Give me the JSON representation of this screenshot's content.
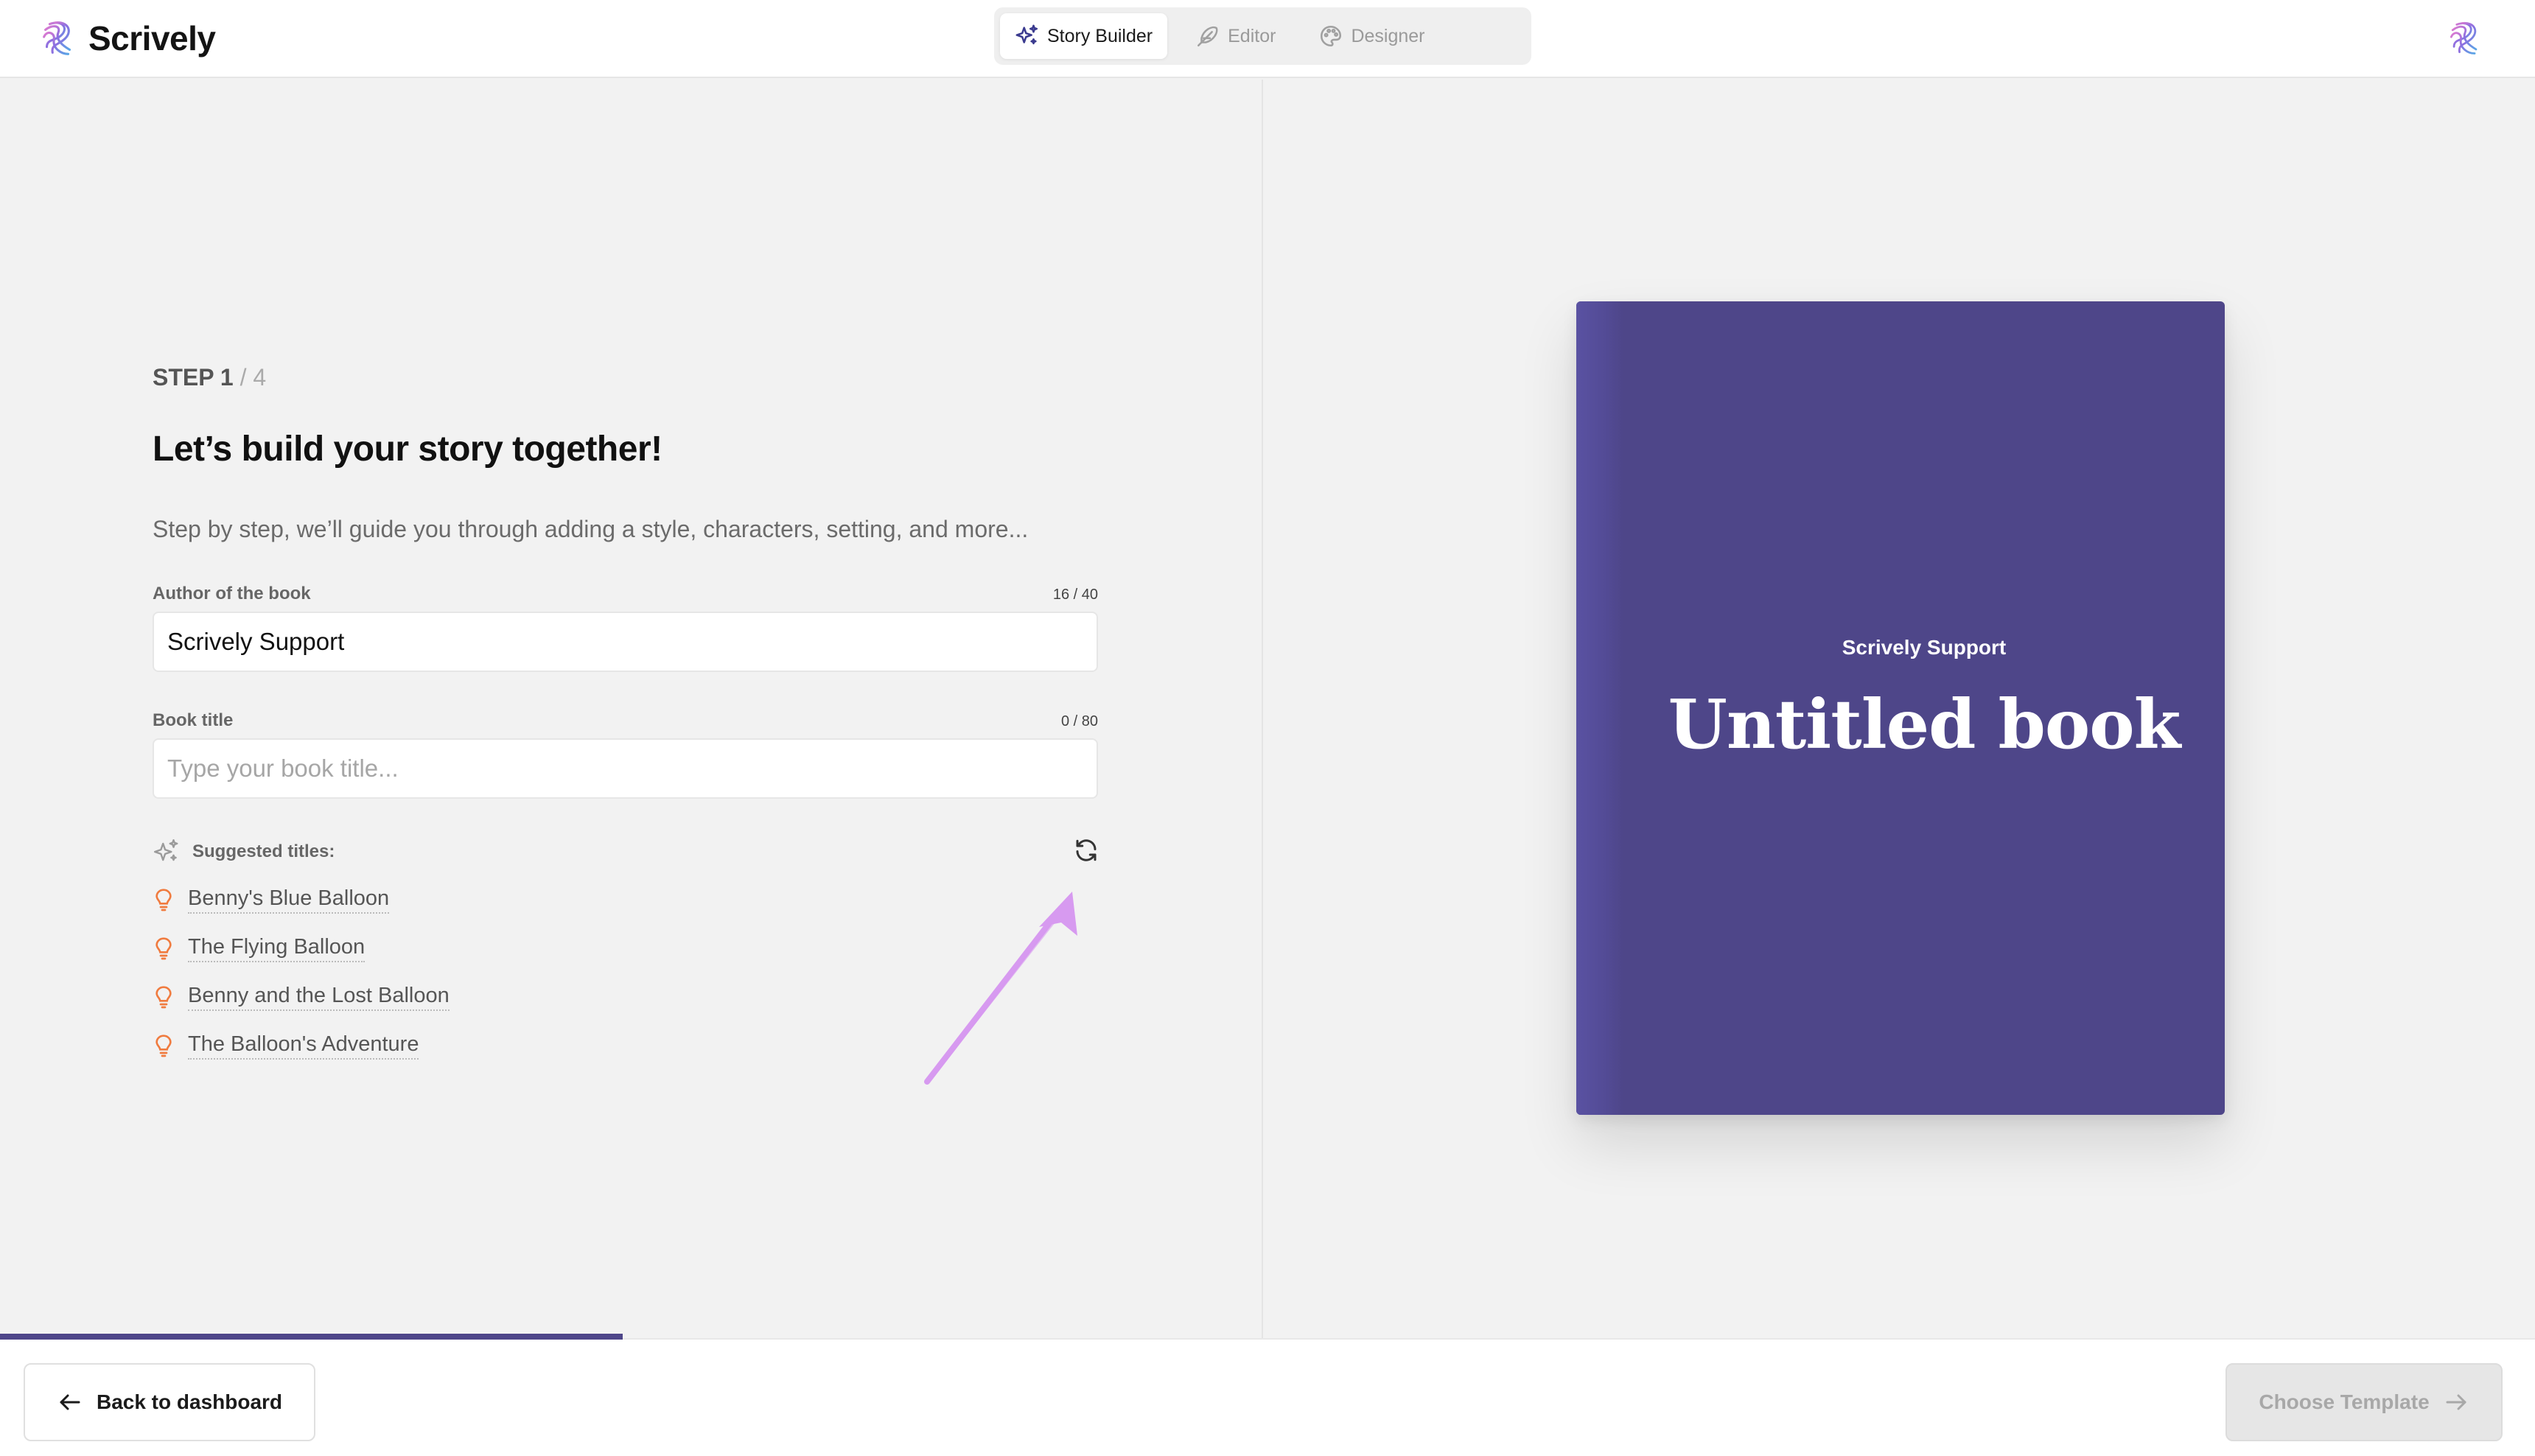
{
  "app": {
    "name": "Scrively"
  },
  "nav": {
    "tabs": [
      {
        "label": "Story Builder",
        "icon": "sparkles-icon",
        "active": true
      },
      {
        "label": "Editor",
        "icon": "feather-icon",
        "active": false
      },
      {
        "label": "Designer",
        "icon": "palette-icon",
        "active": false
      }
    ]
  },
  "step": {
    "current": "STEP 1",
    "total": "/ 4"
  },
  "headline": "Let’s build your story together!",
  "subtitle": "Step by step, we’ll guide you through adding a style, characters, setting, and more...",
  "author": {
    "label": "Author of the book",
    "counter": "16 / 40",
    "value": "Scrively Support"
  },
  "book_title": {
    "label": "Book title",
    "counter": "0 / 80",
    "value": "",
    "placeholder": "Type your book title..."
  },
  "suggestions": {
    "heading": "Suggested titles:",
    "items": [
      "Benny's Blue Balloon",
      "The Flying Balloon",
      "Benny and the Lost Balloon",
      "The Balloon's Adventure"
    ]
  },
  "cover": {
    "author": "Scrively Support",
    "title": "Untitled book",
    "color": "#4e4689"
  },
  "footer": {
    "back_label": "Back to dashboard",
    "next_label": "Choose Template",
    "progress_fraction": 0.25
  },
  "colors": {
    "accent": "#4e4689",
    "suggestion_icon": "#f07b3f",
    "annotation_arrow": "#d79af0"
  }
}
